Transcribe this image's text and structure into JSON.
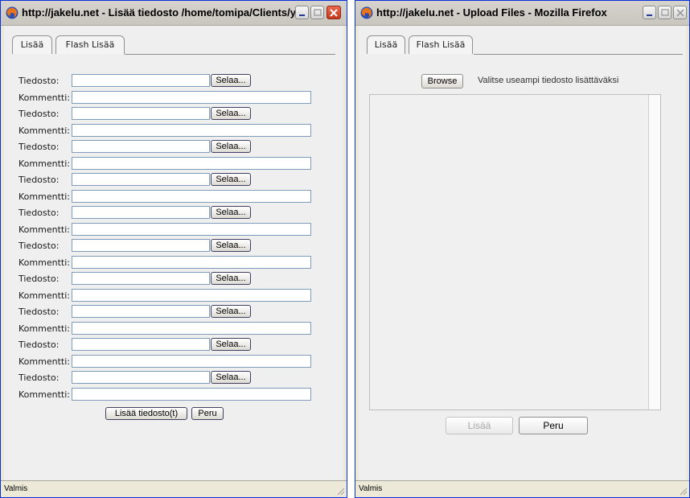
{
  "left_window": {
    "title": "http://jakelu.net - Lisää tiedosto /home/tomipa/Clients/y...",
    "tabs": [
      {
        "label": "Lisää"
      },
      {
        "label": "Flash Lisää"
      }
    ],
    "file_label": "Tiedosto:",
    "comment_label": "Kommentti:",
    "browse_label": "Selaa...",
    "row_count": 10,
    "submit_label": "Lisää tiedosto(t)",
    "cancel_label": "Peru",
    "status": "Valmis"
  },
  "right_window": {
    "title": "http://jakelu.net - Upload Files - Mozilla Firefox",
    "tabs": [
      {
        "label": "Lisää"
      },
      {
        "label": "Flash Lisää"
      }
    ],
    "browse_label": "Browse",
    "hint": "Valitse useampi tiedosto lisättäväksi",
    "add_label": "Lisää",
    "cancel_label": "Peru",
    "status": "Valmis"
  },
  "icons": {
    "browser": "firefox-icon",
    "minimize": "minimize-icon",
    "maximize": "maximize-icon",
    "close": "close-icon"
  },
  "colors": {
    "titlebar": "#d0cdc8",
    "border": "#0831d9",
    "close": "#d44a2b"
  }
}
